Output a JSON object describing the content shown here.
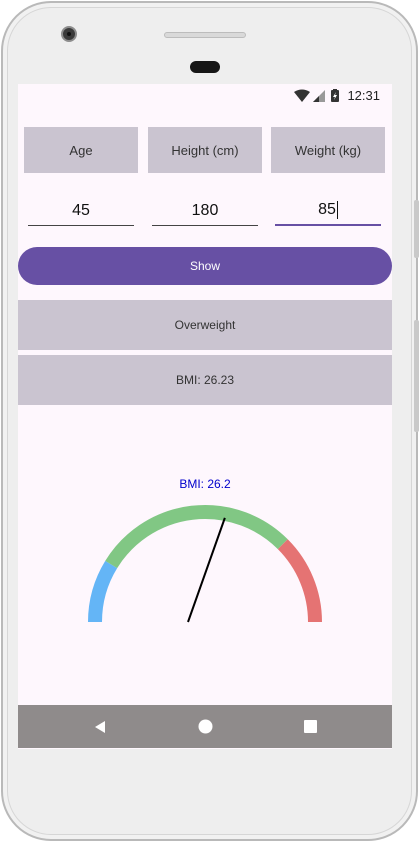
{
  "status_bar": {
    "time": "12:31",
    "icons": [
      "wifi-icon",
      "cell-signal-icon",
      "battery-charging-icon"
    ]
  },
  "labels": {
    "age": "Age",
    "height": "Height (cm)",
    "weight": "Weight (kg)"
  },
  "inputs": {
    "age": "45",
    "height": "180",
    "weight": "85"
  },
  "show_button": "Show",
  "results": {
    "category": "Overweight",
    "bmi_text": "BMI: 26.23"
  },
  "gauge": {
    "label": "BMI: 26.2",
    "value": 26.2,
    "min": 15,
    "max": 35,
    "segments": [
      {
        "from": 15,
        "to": 18.5,
        "color": "#64b5f6"
      },
      {
        "from": 18.5,
        "to": 30,
        "color": "#81c784"
      },
      {
        "from": 30,
        "to": 35,
        "color": "#e57373"
      }
    ],
    "label_color": "#0000cc",
    "needle_color": "#000000"
  },
  "colors": {
    "accent": "#6750a4",
    "box": "#cac4d0",
    "background": "#fef7fd"
  },
  "nav_bar": [
    "back-icon",
    "home-icon",
    "recents-icon"
  ]
}
